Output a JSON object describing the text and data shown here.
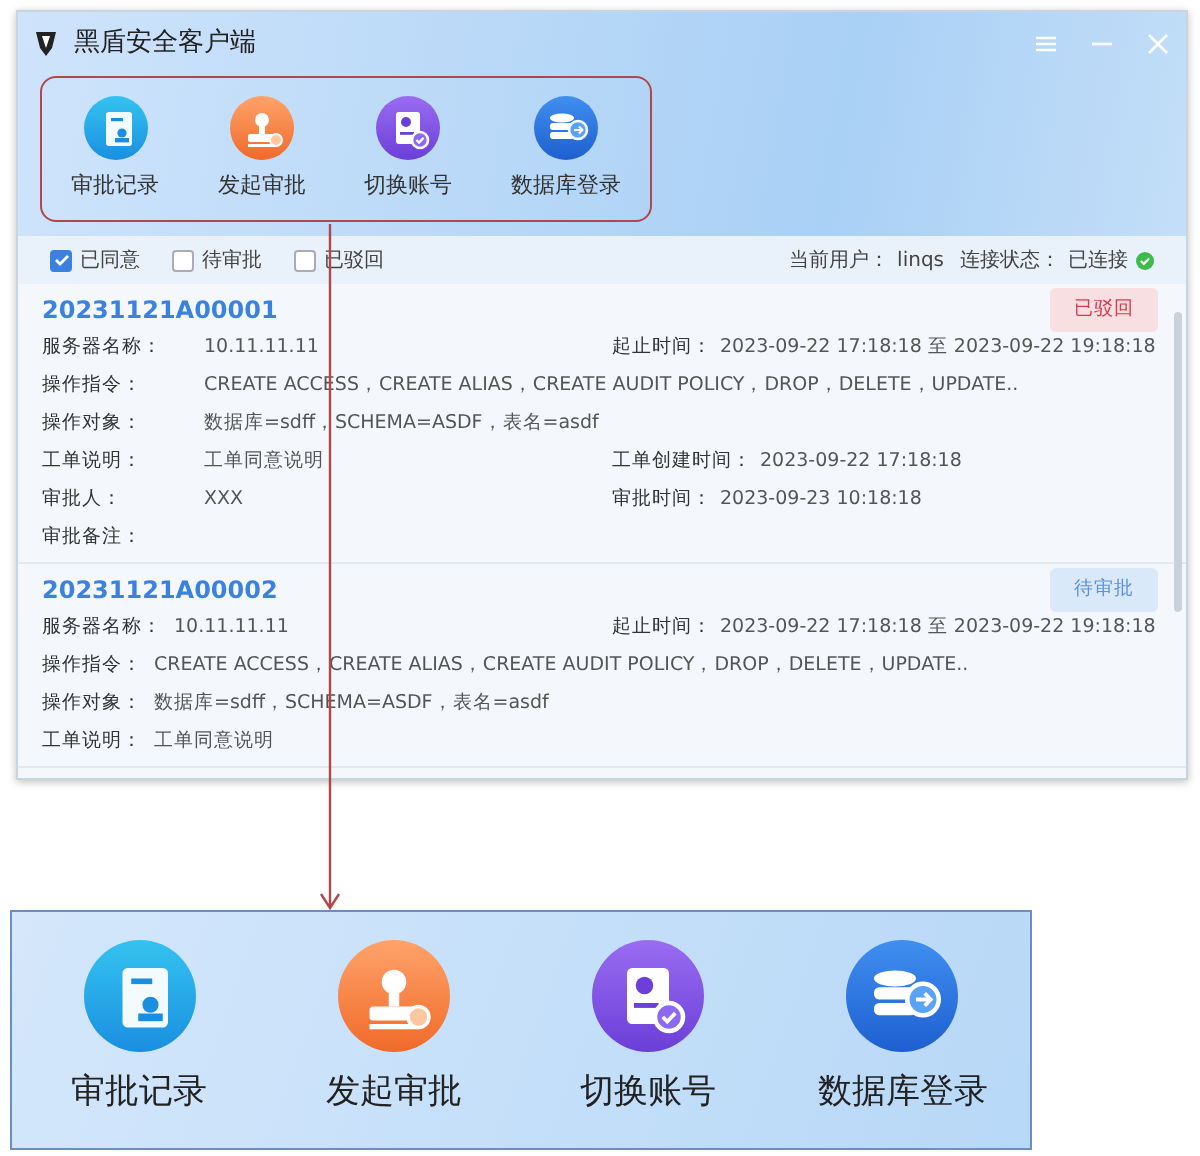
{
  "window": {
    "title": "黑盾安全客户端"
  },
  "toolbar": {
    "buttons": [
      {
        "label": "审批记录",
        "kind": "records"
      },
      {
        "label": "发起审批",
        "kind": "stamp"
      },
      {
        "label": "切换账号",
        "kind": "account"
      },
      {
        "label": "数据库登录",
        "kind": "database"
      }
    ]
  },
  "filters": [
    {
      "label": "已同意",
      "checked": true
    },
    {
      "label": "待审批",
      "checked": false
    },
    {
      "label": "已驳回",
      "checked": false
    }
  ],
  "status": {
    "user_label": "当前用户：",
    "user": "linqs",
    "connection_label": "连接状态：",
    "connection": "已连接"
  },
  "records": [
    {
      "id": "20231121A00001",
      "status": {
        "label": "已驳回",
        "kind": "rejected"
      },
      "rows": [
        {
          "left": {
            "label": "服务器名称：",
            "value": "10.11.11.11"
          },
          "right": {
            "label": "起止时间：",
            "value": "2023-09-22 17:18:18 至 2023-09-22 19:18:18"
          }
        },
        {
          "left": {
            "label": "操作指令：",
            "value": "CREATE ACCESS，CREATE ALIAS，CREATE AUDIT POLICY，DROP，DELETE，UPDATE.."
          }
        },
        {
          "left": {
            "label": "操作对象：",
            "value": "数据库=sdff，SCHEMA=ASDF，表名=asdf"
          }
        },
        {
          "left": {
            "label": "工单说明：",
            "value": "工单同意说明"
          },
          "right": {
            "label": "工单创建时间：",
            "value": "2023-09-22 17:18:18"
          }
        },
        {
          "left": {
            "label": "审批人：",
            "value": "XXX"
          },
          "right": {
            "label": "审批时间：",
            "value": "2023-09-23 10:18:18"
          }
        },
        {
          "left": {
            "label": "审批备注："
          }
        }
      ]
    },
    {
      "id": "20231121A00002",
      "status": {
        "label": "待审批",
        "kind": "pending"
      },
      "rows": [
        {
          "left": {
            "label": "服务器名称：",
            "value": "10.11.11.11"
          },
          "right": {
            "label": "起止时间：",
            "value": "2023-09-22 17:18:18 至 2023-09-22 19:18:18"
          }
        },
        {
          "left": {
            "label": "操作指令：",
            "value": "CREATE ACCESS，CREATE ALIAS，CREATE AUDIT POLICY，DROP，DELETE，UPDATE.."
          }
        },
        {
          "left": {
            "label": "操作对象：",
            "value": "数据库=sdff，SCHEMA=ASDF，表名=asdf"
          }
        },
        {
          "left": {
            "label": "工单说明：",
            "value": "工单同意说明"
          }
        }
      ]
    }
  ],
  "callout": {
    "buttons": [
      {
        "label": "审批记录",
        "kind": "records"
      },
      {
        "label": "发起审批",
        "kind": "stamp"
      },
      {
        "label": "切换账号",
        "kind": "account"
      },
      {
        "label": "数据库登录",
        "kind": "database"
      }
    ]
  }
}
